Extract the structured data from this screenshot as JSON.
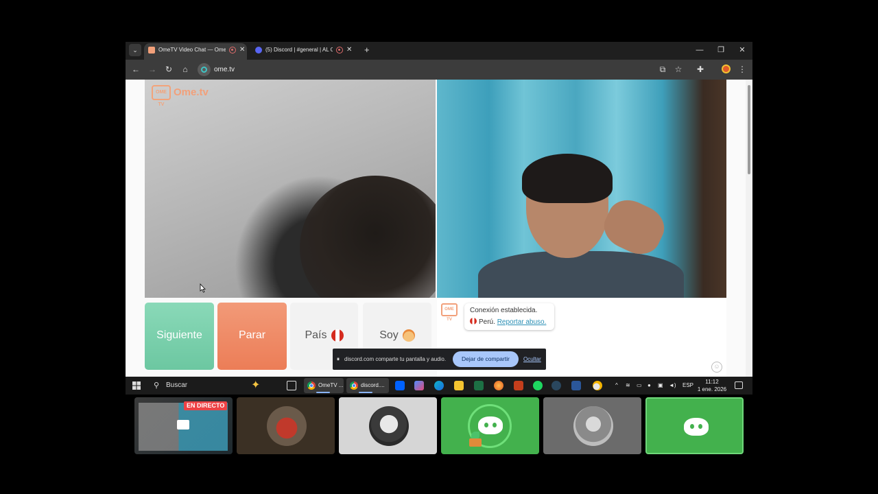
{
  "browser": {
    "tab_list_icon": "chevron-down-icon",
    "tabs": [
      {
        "title": "OmeTV Video Chat — Ome",
        "active": true
      },
      {
        "title": "(5) Discord | #general | AL C",
        "active": false
      }
    ],
    "url": "ome.tv"
  },
  "page": {
    "logo_text": "Ome.tv",
    "logo_badge": "OME TV",
    "buttons": {
      "next": "Siguiente",
      "stop": "Parar",
      "country": "País",
      "gender": "Soy"
    },
    "chat": {
      "status": "Conexión establecida.",
      "country": "Perú.",
      "report_link": "Reportar abuso."
    }
  },
  "share_bar": {
    "message": "discord.com comparte tu pantalla y audio.",
    "stop_label": "Dejar de compartir",
    "hide_label": "Ocultar"
  },
  "taskbar": {
    "search_label": "Buscar",
    "apps": [
      {
        "label": "OmeTV ...",
        "selected": true
      },
      {
        "label": "discord....",
        "selected": true
      }
    ],
    "language": "ESP",
    "time": "11:12",
    "date": "1 ene. 2026"
  },
  "call_strip": {
    "live_label": "EN DIRECTO"
  },
  "colors": {
    "next_button": "#6cc7a1",
    "stop_button": "#ec7d57",
    "discord_green": "#43b14d",
    "live_red": "#ed4245"
  }
}
